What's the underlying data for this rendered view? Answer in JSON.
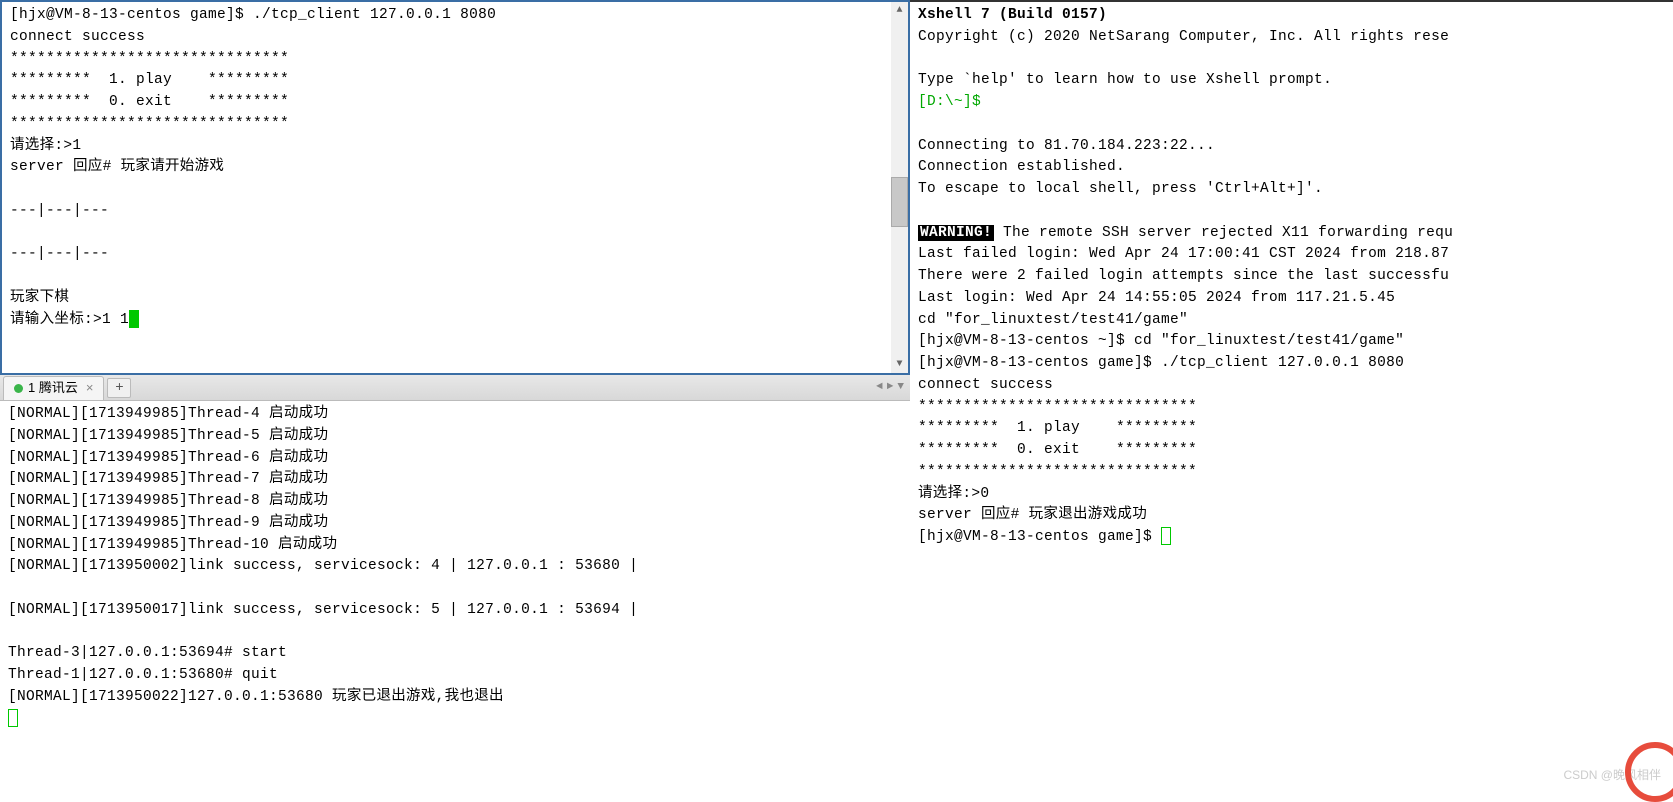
{
  "topLeft": {
    "lines": [
      "[hjx@VM-8-13-centos game]$ ./tcp_client 127.0.0.1 8080",
      "connect success",
      "*******************************",
      "*********  1. play    *********",
      "*********  0. exit    *********",
      "*******************************",
      "请选择:>1",
      "server 回应# 玩家请开始游戏",
      "",
      "---|---|---",
      "",
      "---|---|---",
      "",
      "玩家下棋",
      "请输入坐标:>1 1"
    ],
    "cursor": true
  },
  "tabBar": {
    "activeTab": "1 腾讯云",
    "addLabel": "+"
  },
  "bottomLeft": {
    "lines": [
      "[NORMAL][1713949985]Thread-4 启动成功",
      "[NORMAL][1713949985]Thread-5 启动成功",
      "[NORMAL][1713949985]Thread-6 启动成功",
      "[NORMAL][1713949985]Thread-7 启动成功",
      "[NORMAL][1713949985]Thread-8 启动成功",
      "[NORMAL][1713949985]Thread-9 启动成功",
      "[NORMAL][1713949985]Thread-10 启动成功",
      "[NORMAL][1713950002]link success, servicesock: 4 | 127.0.0.1 : 53680 |",
      "",
      "[NORMAL][1713950017]link success, servicesock: 5 | 127.0.0.1 : 53694 |",
      "",
      "Thread-3|127.0.0.1:53694# start",
      "Thread-1|127.0.0.1:53680# quit",
      "[NORMAL][1713950022]127.0.0.1:53680 玩家已退出游戏,我也退出"
    ],
    "cursor": true
  },
  "right": {
    "titleLine": "Xshell 7 (Build 0157)",
    "copyright": "Copyright (c) 2020 NetSarang Computer, Inc. All rights rese",
    "helpLine": "Type `help' to learn how to use Xshell prompt.",
    "promptLocal": "[D:\\~]$",
    "connecting": "Connecting to 81.70.184.223:22...",
    "established": "Connection established.",
    "escape": "To escape to local shell, press 'Ctrl+Alt+]'.",
    "warningLabel": "WARNING!",
    "warningText": " The remote SSH server rejected X11 forwarding requ",
    "lastFailed": "Last failed login: Wed Apr 24 17:00:41 CST 2024 from 218.87",
    "failedAttempts": "There were 2 failed login attempts since the last successfu",
    "lastLogin": "Last login: Wed Apr 24 14:55:05 2024 from 117.21.5.45",
    "cdEcho": "cd \"for_linuxtest/test41/game\"",
    "cdCmd": "[hjx@VM-8-13-centos ~]$ cd \"for_linuxtest/test41/game\"",
    "runCmd": "[hjx@VM-8-13-centos game]$ ./tcp_client 127.0.0.1 8080",
    "connectSuccess": "connect success",
    "stars1": "*******************************",
    "menuPlay": "*********  1. play    *********",
    "menuExit": "*********  0. exit    *********",
    "stars2": "*******************************",
    "choice": "请选择:>0",
    "serverResp": "server 回应# 玩家退出游戏成功",
    "finalPrompt": "[hjx@VM-8-13-centos game]$ "
  },
  "watermark": "CSDN @晚风相伴"
}
